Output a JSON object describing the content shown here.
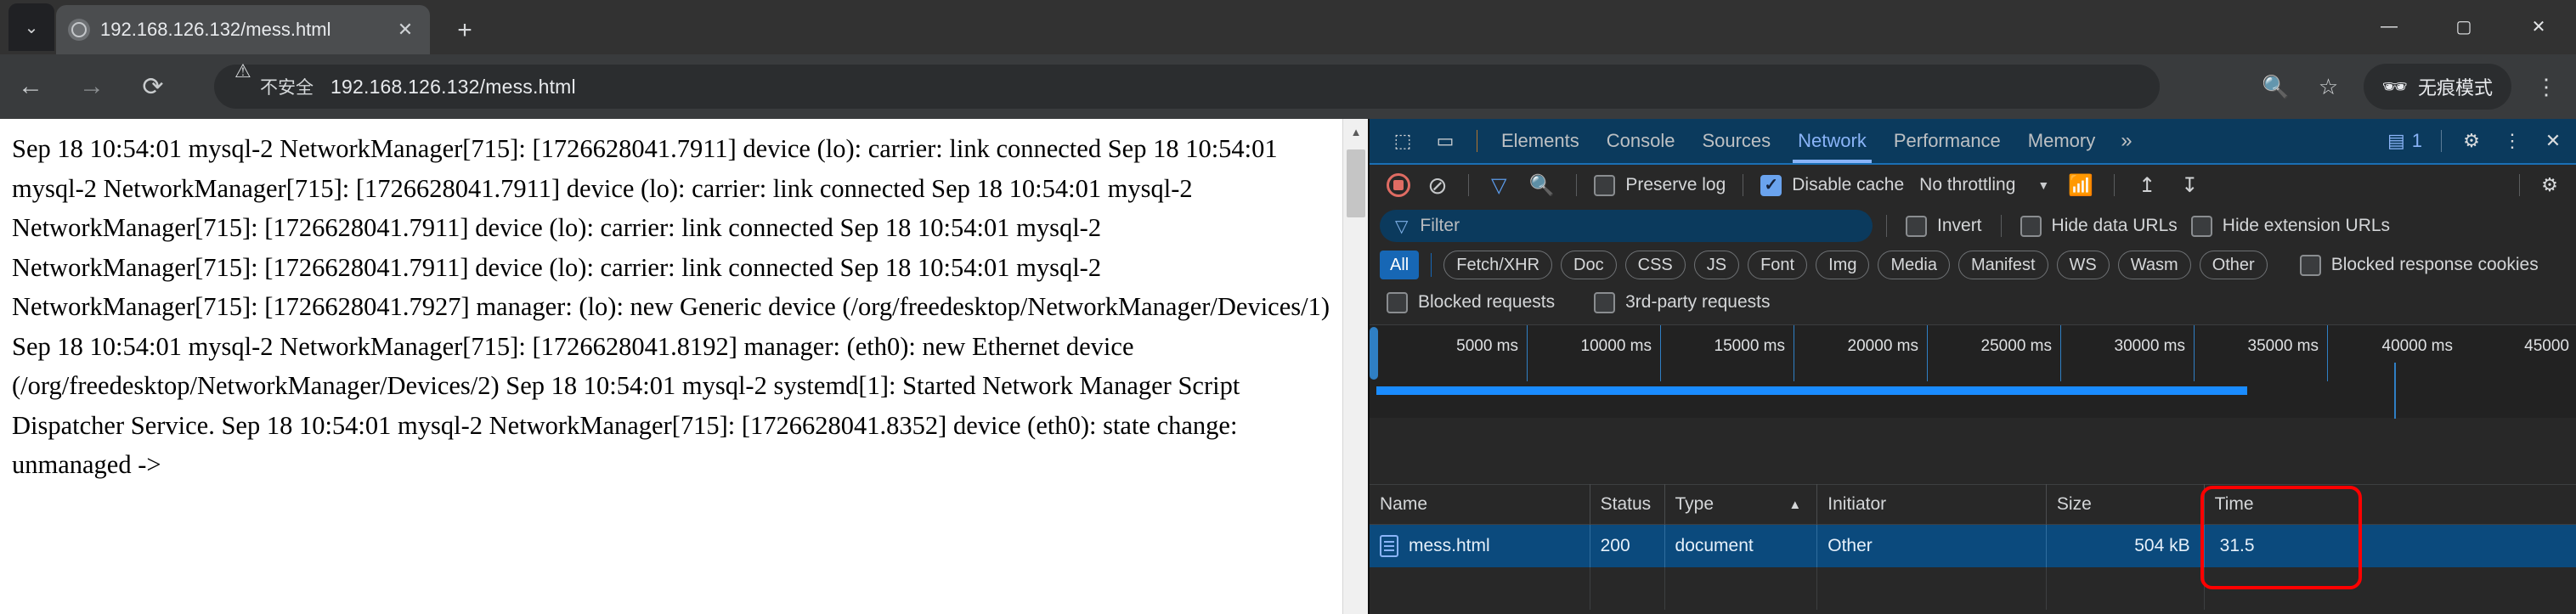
{
  "browser": {
    "tab": {
      "title": "192.168.126.132/mess.html",
      "favicon": "globe-icon",
      "close": "✕"
    },
    "new_tab": "+",
    "tab_list_chevron": "⌄",
    "window_controls": {
      "minimize": "—",
      "maximize": "▢",
      "close": "✕"
    },
    "nav": {
      "back": "←",
      "forward": "→",
      "reload": "⟳"
    },
    "omnibox": {
      "security_label": "不安全",
      "security_icon": "warning-triangle-icon",
      "url": "192.168.126.132/mess.html"
    },
    "actions": {
      "zoom_icon": "🔍",
      "bookmark_icon": "☆",
      "incognito_label": "无痕模式",
      "incognito_icon": "🕶",
      "menu_icon": "⋮"
    }
  },
  "page": {
    "body_text": "Sep 18 10:54:01 mysql-2 NetworkManager[715]: [1726628041.7911] device (lo): carrier: link connected Sep 18 10:54:01 mysql-2 NetworkManager[715]: [1726628041.7911] device (lo): carrier: link connected Sep 18 10:54:01 mysql-2 NetworkManager[715]: [1726628041.7911] device (lo): carrier: link connected Sep 18 10:54:01 mysql-2 NetworkManager[715]: [1726628041.7911] device (lo): carrier: link connected Sep 18 10:54:01 mysql-2 NetworkManager[715]: [1726628041.7927] manager: (lo): new Generic device (/org/freedesktop/NetworkManager/Devices/1) Sep 18 10:54:01 mysql-2 NetworkManager[715]: [1726628041.8192] manager: (eth0): new Ethernet device (/org/freedesktop/NetworkManager/Devices/2) Sep 18 10:54:01 mysql-2 systemd[1]: Started Network Manager Script Dispatcher Service. Sep 18 10:54:01 mysql-2 NetworkManager[715]: [1726628041.8352] device (eth0): state change: unmanaged ->",
    "scrollbar_up": "▲"
  },
  "devtools": {
    "tools": {
      "inspect_icon": "⬚",
      "device_icon": "▭"
    },
    "tabs": [
      {
        "label": "Elements",
        "active": false
      },
      {
        "label": "Console",
        "active": false
      },
      {
        "label": "Sources",
        "active": false
      },
      {
        "label": "Network",
        "active": true
      },
      {
        "label": "Performance",
        "active": false
      },
      {
        "label": "Memory",
        "active": false
      }
    ],
    "more_tabs": "»",
    "message_count": "1",
    "message_icon": "▤",
    "settings_icon": "⚙",
    "kebab_icon": "⋮",
    "close_icon": "✕",
    "toolbar": {
      "record_label": "record-button",
      "clear_label": "⊘",
      "filter_icon": "▽",
      "search_icon": "🔍",
      "preserve_log": {
        "label": "Preserve log",
        "checked": false
      },
      "disable_cache": {
        "label": "Disable cache",
        "checked": true
      },
      "throttling": "No throttling",
      "throttle_caret": "▼",
      "wifi_icon": "📶",
      "import_icon": "↥",
      "export_icon": "↧",
      "settings_icon": "⚙"
    },
    "filter_bar": {
      "filter_icon": "▽",
      "filter_placeholder": "Filter",
      "invert": {
        "label": "Invert",
        "checked": false
      },
      "hide_data_urls": {
        "label": "Hide data URLs",
        "checked": false
      },
      "hide_extension_urls": {
        "label": "Hide extension URLs",
        "checked": false
      }
    },
    "type_filters": [
      {
        "label": "All",
        "active": true
      },
      {
        "label": "Fetch/XHR",
        "active": false
      },
      {
        "label": "Doc",
        "active": false
      },
      {
        "label": "CSS",
        "active": false
      },
      {
        "label": "JS",
        "active": false
      },
      {
        "label": "Font",
        "active": false
      },
      {
        "label": "Img",
        "active": false
      },
      {
        "label": "Media",
        "active": false
      },
      {
        "label": "Manifest",
        "active": false
      },
      {
        "label": "WS",
        "active": false
      },
      {
        "label": "Wasm",
        "active": false
      },
      {
        "label": "Other",
        "active": false
      }
    ],
    "blocked_response_cookies": {
      "label": "Blocked response cookies",
      "checked": false
    },
    "blocked_requests": {
      "label": "Blocked requests",
      "checked": false
    },
    "third_party_requests": {
      "label": "3rd-party requests",
      "checked": false
    },
    "timeline": {
      "ticks": [
        "5000 ms",
        "10000 ms",
        "15000 ms",
        "20000 ms",
        "25000 ms",
        "30000 ms",
        "35000 ms",
        "40000 ms",
        "45000"
      ]
    },
    "table": {
      "columns": [
        "Name",
        "Status",
        "Type",
        "Initiator",
        "Size",
        "Time"
      ],
      "sort_column": "Type",
      "sort_caret": "▲",
      "rows": [
        {
          "name": "mess.html",
          "status": "200",
          "type": "document",
          "initiator": "Other",
          "size": "504 kB",
          "time": "31.5"
        }
      ]
    }
  }
}
